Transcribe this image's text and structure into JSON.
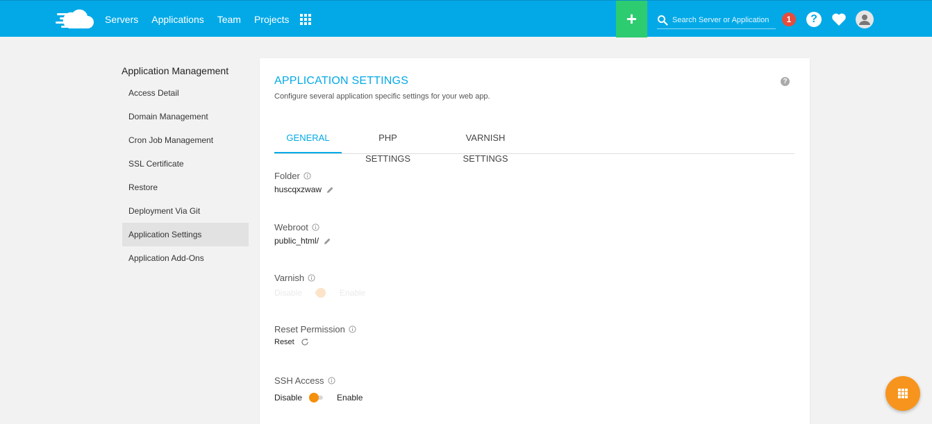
{
  "topbar": {
    "nav": [
      "Servers",
      "Applications",
      "Team",
      "Projects"
    ],
    "add_label": "+",
    "search_placeholder": "Search Server or Application",
    "notification_count": "1",
    "help_label": "?",
    "colors": {
      "primary": "#03a9e7",
      "add": "#2ecc71",
      "badge": "#e74c3c"
    },
    "icons": [
      "cloudways-logo-icon",
      "apps-grid-icon",
      "search-icon",
      "help-icon",
      "heart-icon",
      "user-avatar-icon"
    ]
  },
  "sidebar": {
    "title": "Application Management",
    "items": [
      {
        "label": "Access Detail"
      },
      {
        "label": "Domain Management"
      },
      {
        "label": "Cron Job Management"
      },
      {
        "label": "SSL Certificate"
      },
      {
        "label": "Restore"
      },
      {
        "label": "Deployment Via Git"
      },
      {
        "label": "Application Settings",
        "active": true
      },
      {
        "label": "Application Add-Ons"
      }
    ]
  },
  "main": {
    "title": "APPLICATION SETTINGS",
    "subtitle": "Configure several application specific settings for your web app.",
    "help_label": "?",
    "tabs": [
      {
        "label": "GENERAL",
        "active": true
      },
      {
        "label": "PHP SETTINGS"
      },
      {
        "label": "VARNISH SETTINGS"
      }
    ],
    "fields": {
      "folder": {
        "label": "Folder",
        "value": "huscqxzwaw"
      },
      "webroot": {
        "label": "Webroot",
        "value": "public_html/"
      },
      "varnish": {
        "label": "Varnish",
        "off_label": "Disable",
        "on_label": "Enable",
        "enabled": false,
        "state": "disabled"
      },
      "reset_permission": {
        "label": "Reset Permission",
        "action": "Reset"
      },
      "ssh_access": {
        "label": "SSH Access",
        "off_label": "Disable",
        "on_label": "Enable",
        "enabled": false
      }
    },
    "accent_toggle_color": "#f4900b"
  },
  "fab": {
    "icon": "apps-grid-icon",
    "color": "#f7941d"
  }
}
